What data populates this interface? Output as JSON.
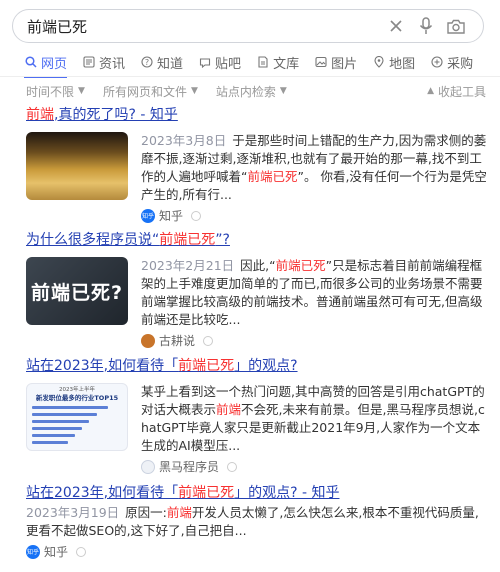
{
  "search": {
    "query": "前端已死"
  },
  "tabs": [
    {
      "label": "网页",
      "icon": "search-icon"
    },
    {
      "label": "资讯",
      "icon": "news-icon"
    },
    {
      "label": "知道",
      "icon": "question-icon"
    },
    {
      "label": "贴吧",
      "icon": "tieba-icon"
    },
    {
      "label": "文库",
      "icon": "document-icon"
    },
    {
      "label": "图片",
      "icon": "image-icon"
    },
    {
      "label": "地图",
      "icon": "map-icon"
    },
    {
      "label": "采购",
      "icon": "cart-icon"
    }
  ],
  "filters": {
    "time": "时间不限",
    "type": "所有网页和文件",
    "site": "站点内检索",
    "collapse": "收起工具"
  },
  "colors": {
    "accent": "#4e6ef2",
    "link": "#2440b3",
    "highlight": "#f73131"
  },
  "results": [
    {
      "title_hl": "前端",
      "title_rest": ",真的死了吗? - 知乎",
      "date": "2023年3月8日",
      "snippet_a": "于是那些时间上错配的生产力,因为需求侧的萎靡不振,逐渐过剩,逐渐堆积,也就有了最开始的那一幕,找不到工作的人遍地呼喊着“",
      "snippet_hl": "前端已死",
      "snippet_b": "”。 你看,没有任何一个行为是凭空产生的,所有行...",
      "source": "知乎",
      "source_logo_text": "知乎"
    },
    {
      "title_pre": "为什么很多程序员说“",
      "title_hl": "前端已死",
      "title_post": "”?",
      "thumb_text": "前端已死?",
      "date": "2023年2月21日",
      "snippet_a": "因此,“",
      "snippet_hl": "前端已死",
      "snippet_b": "”只是标志着目前前端编程框架的上手难度更加简单的了而已,而很多公司的业务场景不需要前端掌握比较高级的前端技术。普通前端虽然可有可无,但高级前端还是比较吃...",
      "source": "古耕说"
    },
    {
      "title_pre": "站在2023年,如何看待「",
      "title_hl": "前端已死",
      "title_post": "」的观点?",
      "thumb_line1": "2023年上半年",
      "thumb_line2": "新发职位最多的行业TOP15",
      "snippet_a": "某乎上看到这一个热门问题,其中高赞的回答是引用chatGPT的对话大概表示",
      "snippet_hl": "前端",
      "snippet_b": "不会死,未来有前景。但是,黑马程序员想说,chatGPT毕竟人家只是更新截止2021年9月,人家作为一个文本生成的AI模型压...",
      "source": "黑马程序员"
    },
    {
      "title_pre": "站在2023年,如何看待「",
      "title_hl": "前端已死",
      "title_post": "」的观点? - 知乎",
      "date": "2023年3月19日",
      "snippet_a": "原因一:",
      "snippet_hl": "前端",
      "snippet_b": "开发人员太懒了,怎么快怎么来,根本不重视代码质量,更看不起做SEO的,这下好了,自己把自...",
      "source": "知乎",
      "source_logo_text": "知乎"
    }
  ]
}
